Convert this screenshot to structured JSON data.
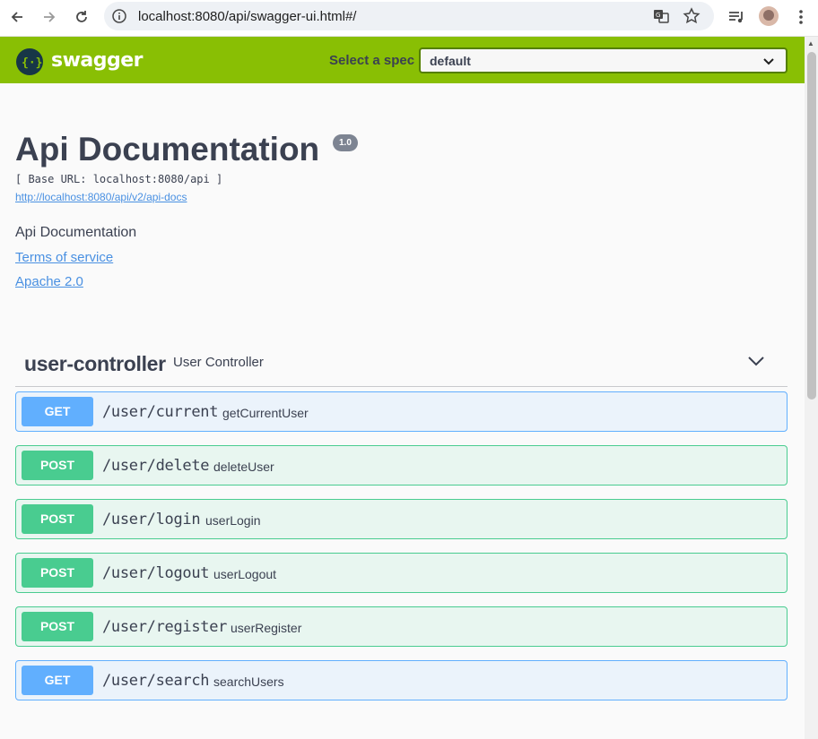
{
  "browser": {
    "url": "localhost:8080/api/swagger-ui.html#/"
  },
  "topbar": {
    "logo_text": "swagger",
    "spec_label": "Select a spec",
    "spec_value": "default"
  },
  "info": {
    "title": "Api Documentation",
    "version": "1.0",
    "base_url": "[ Base URL: localhost:8080/api ]",
    "docs_link": "http://localhost:8080/api/v2/api-docs",
    "description": "Api Documentation",
    "terms": "Terms of service",
    "license": "Apache 2.0"
  },
  "tag": {
    "name": "user-controller",
    "description": "User Controller"
  },
  "operations": [
    {
      "method": "GET",
      "path": "/user/current",
      "summary": "getCurrentUser"
    },
    {
      "method": "POST",
      "path": "/user/delete",
      "summary": "deleteUser"
    },
    {
      "method": "POST",
      "path": "/user/login",
      "summary": "userLogin"
    },
    {
      "method": "POST",
      "path": "/user/logout",
      "summary": "userLogout"
    },
    {
      "method": "POST",
      "path": "/user/register",
      "summary": "userRegister"
    },
    {
      "method": "GET",
      "path": "/user/search",
      "summary": "searchUsers"
    }
  ],
  "colors": {
    "topbar": "#89bf04",
    "get": "#61affe",
    "post": "#49cc90",
    "link": "#4990e2"
  }
}
